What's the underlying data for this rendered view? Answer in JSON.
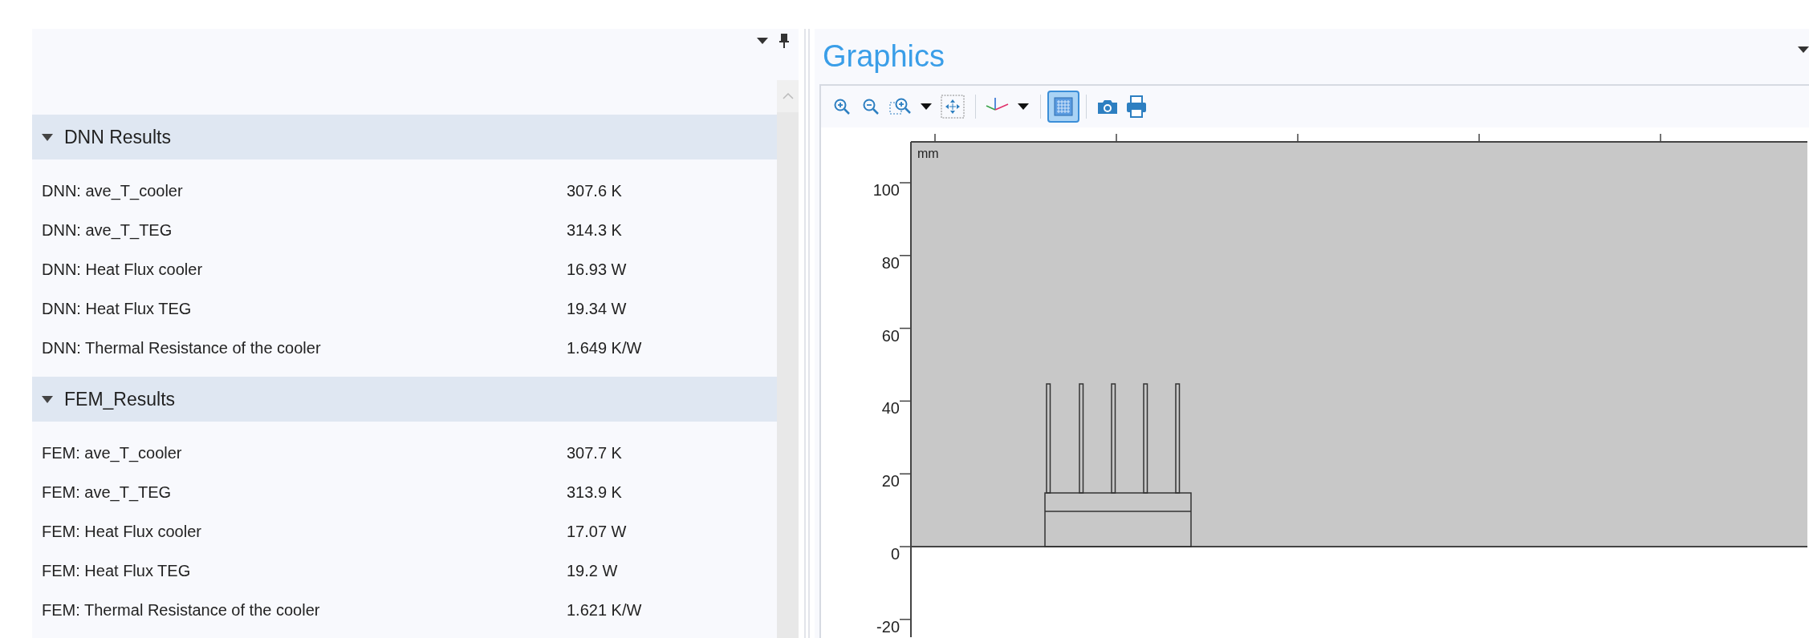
{
  "results_panel": {
    "sections": [
      {
        "title": "DNN Results",
        "expanded": true,
        "rows": [
          {
            "label": "DNN: ave_T_cooler",
            "value": "307.6 K"
          },
          {
            "label": "DNN: ave_T_TEG",
            "value": "314.3 K"
          },
          {
            "label": "DNN: Heat Flux cooler",
            "value": "16.93 W"
          },
          {
            "label": "DNN: Heat Flux TEG",
            "value": "19.34 W"
          },
          {
            "label": "DNN: Thermal Resistance of the cooler",
            "value": "1.649 K/W"
          }
        ]
      },
      {
        "title": "FEM_Results",
        "expanded": true,
        "rows": [
          {
            "label": "FEM: ave_T_cooler",
            "value": "307.7 K"
          },
          {
            "label": "FEM: ave_T_TEG",
            "value": "313.9 K"
          },
          {
            "label": "FEM: Heat Flux cooler",
            "value": "17.07 W"
          },
          {
            "label": "FEM: Heat Flux TEG",
            "value": "19.2 W"
          },
          {
            "label": "FEM: Thermal Resistance of the cooler",
            "value": "1.621 K/W"
          }
        ]
      }
    ]
  },
  "graphics": {
    "title": "Graphics",
    "toolbar": [
      {
        "kind": "zoom-in"
      },
      {
        "kind": "zoom-out"
      },
      {
        "kind": "zoom-box"
      },
      {
        "kind": "caret"
      },
      {
        "kind": "zoom-extents"
      },
      {
        "kind": "separator"
      },
      {
        "kind": "axes"
      },
      {
        "kind": "caret"
      },
      {
        "kind": "separator"
      },
      {
        "kind": "grid",
        "selected": true
      },
      {
        "kind": "separator"
      },
      {
        "kind": "camera"
      },
      {
        "kind": "print"
      }
    ],
    "plot": {
      "unit": "mm",
      "y_tick_labels": [
        "100",
        "80",
        "60",
        "40",
        "20",
        "0",
        "-20"
      ]
    }
  }
}
